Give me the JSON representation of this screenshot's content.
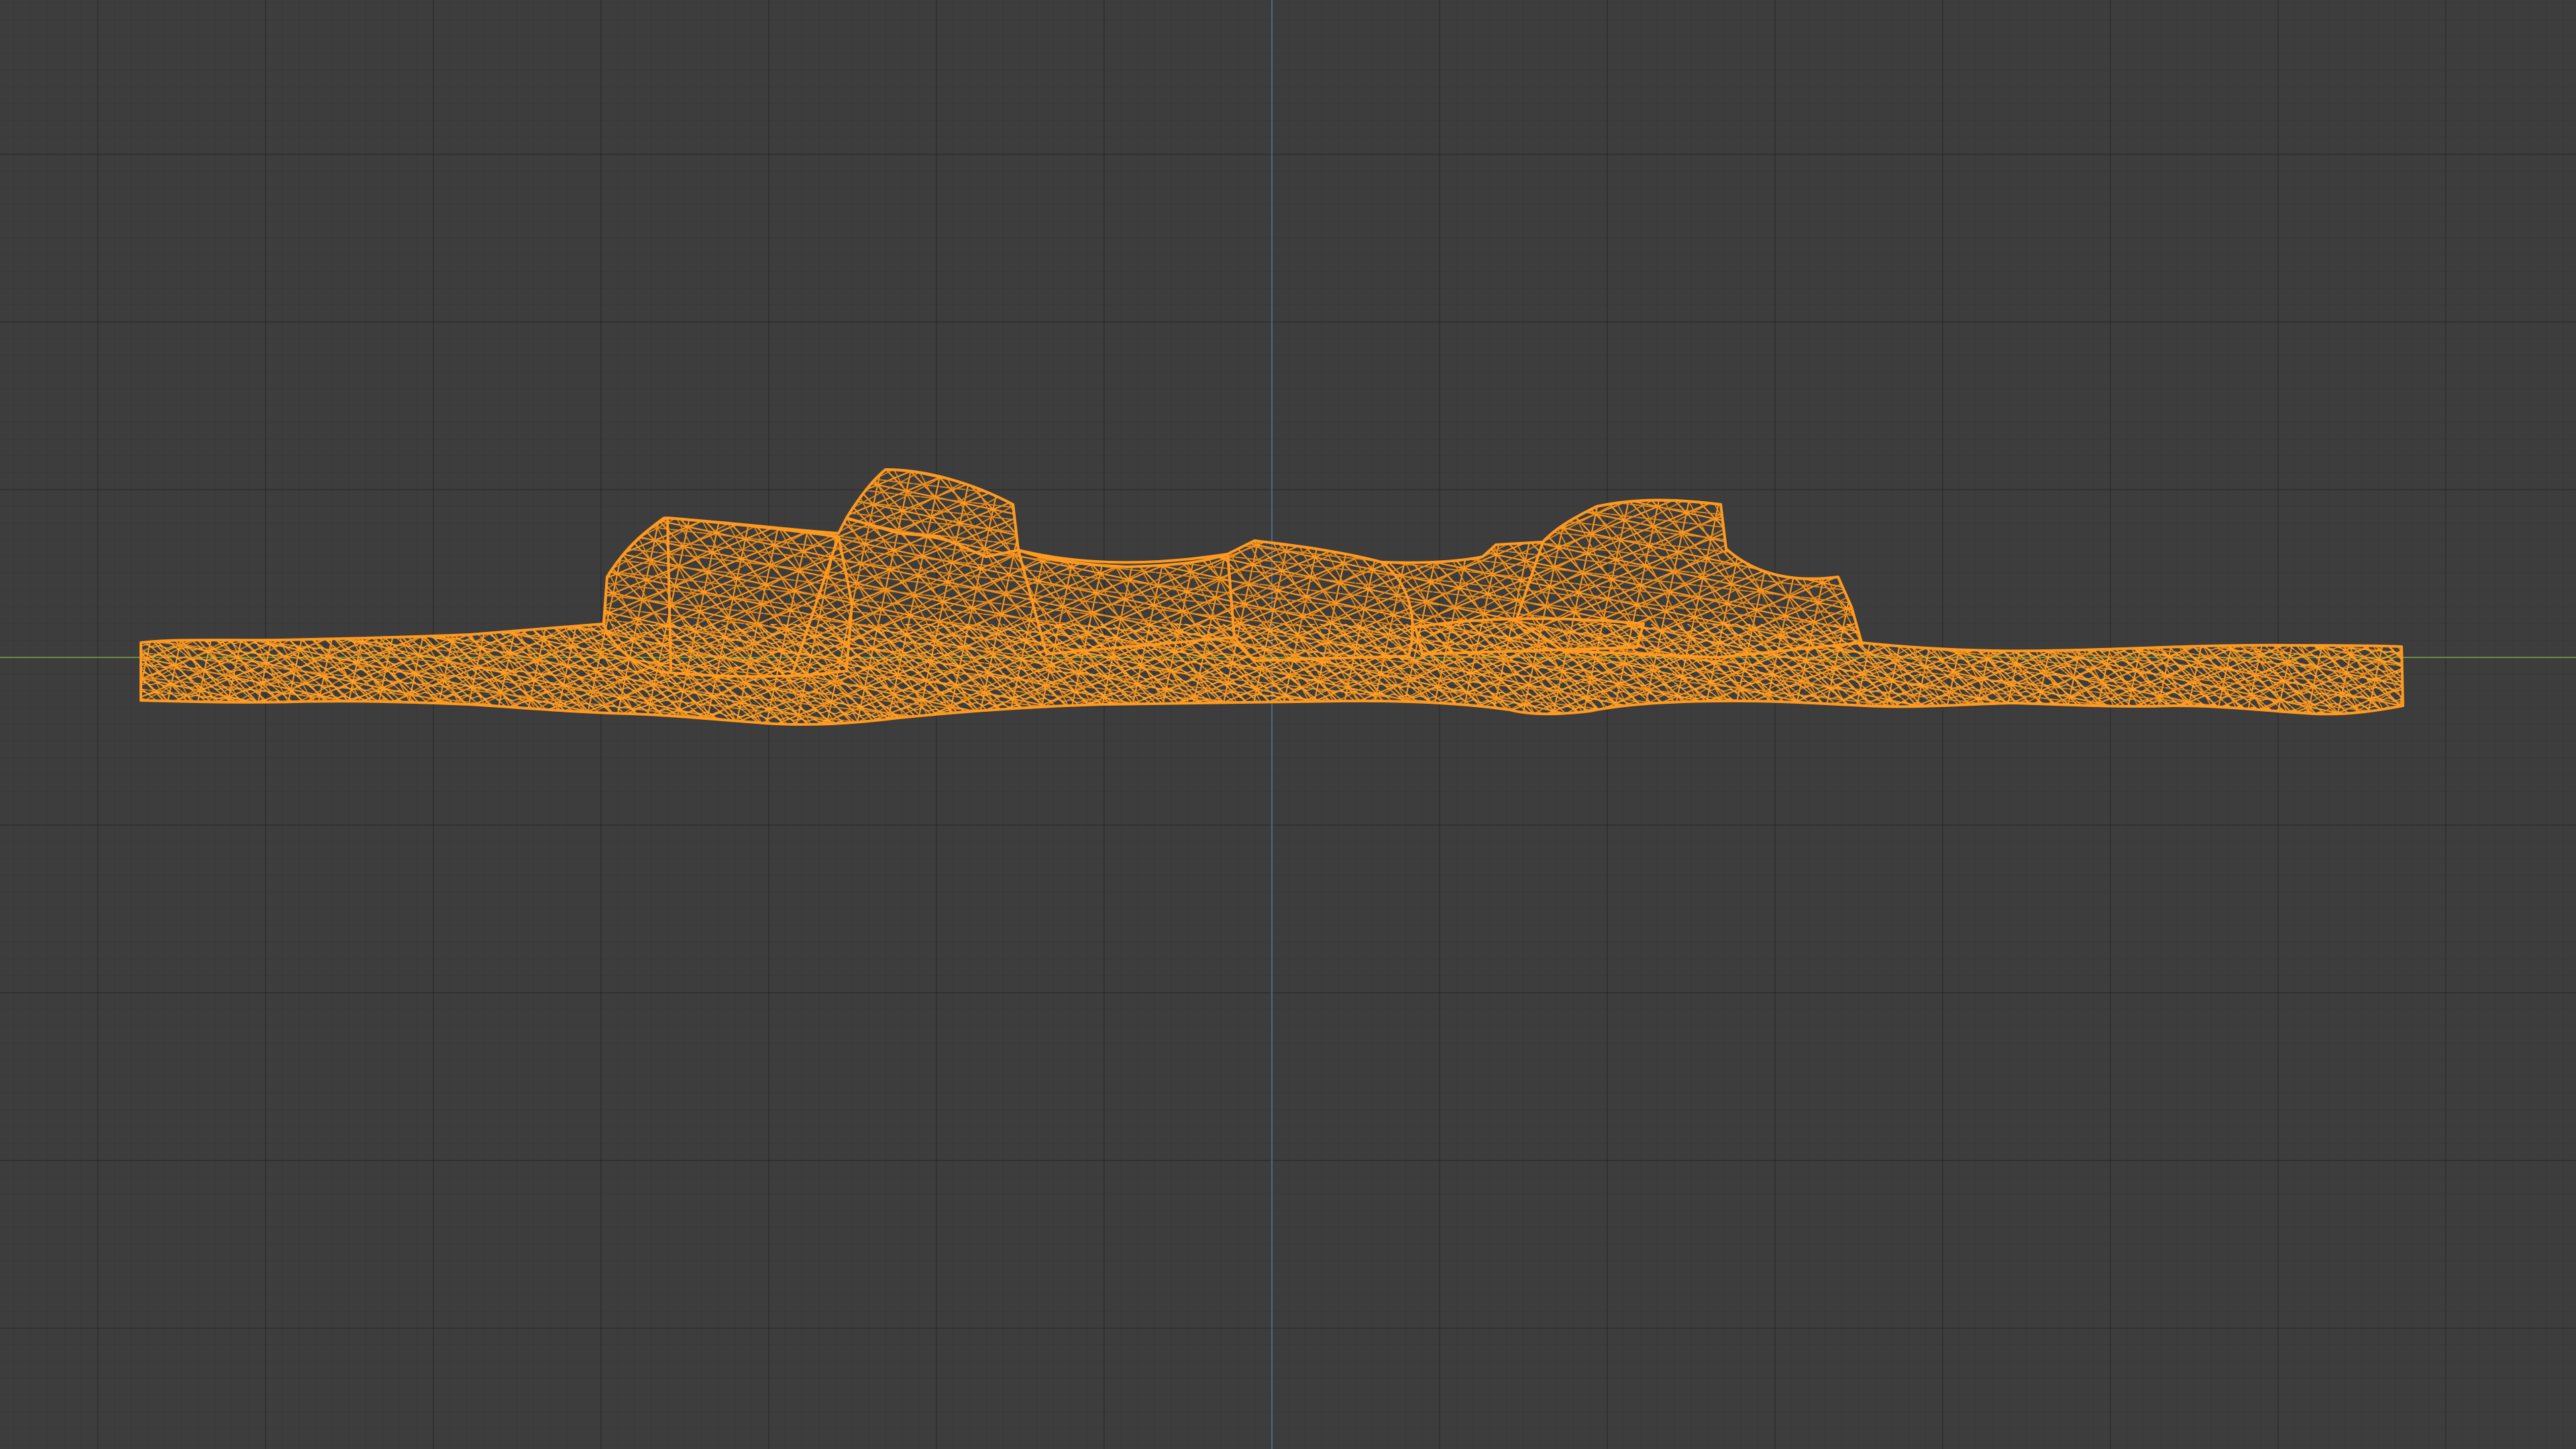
{
  "viewport": {
    "background_color": "#3d3d3d",
    "grid_visible": true
  },
  "axes": {
    "x_color": "#6a8a3c",
    "z_color": "#4a6a8c"
  },
  "mesh": {
    "display_mode": "wireframe",
    "selected": true,
    "wire_color": "#ff9a1f",
    "description_icon": "rock-mesh-icon"
  }
}
